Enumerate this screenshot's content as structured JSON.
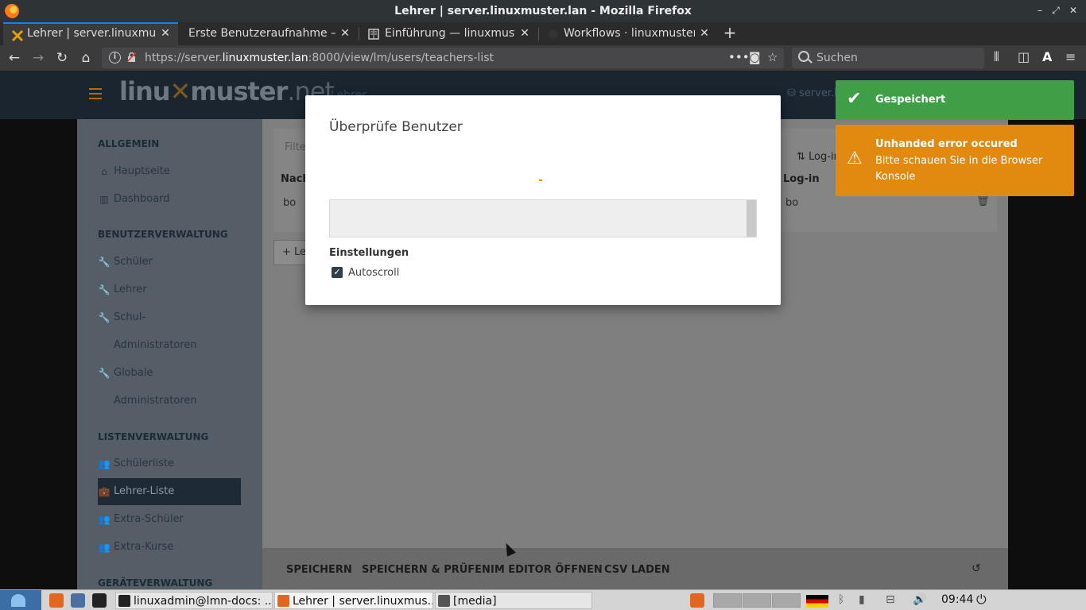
{
  "window": {
    "title": "Lehrer | server.linuxmuster.lan - Mozilla Firefox",
    "controls": [
      "–",
      "⤢",
      "✕"
    ]
  },
  "tabs": [
    {
      "label": "Lehrer | server.linuxmust",
      "icon": "linuxmuster-icon",
      "active": true
    },
    {
      "label": "Erste Benutzeraufnahme —",
      "icon": "",
      "active": false
    },
    {
      "label": "Einführung — linuxmuste",
      "icon": "doc-icon",
      "active": false
    },
    {
      "label": "Workflows · linuxmuster",
      "icon": "github-icon",
      "active": false
    }
  ],
  "navbar": {
    "url_prefix": "https://server.",
    "url_host": "linuxmuster.lan",
    "url_suffix": ":8000/view/lm/users/teachers-list",
    "search_placeholder": "Suchen"
  },
  "header": {
    "logo_a": "linu",
    "logo_x": "✕",
    "logo_b": "muster",
    "logo_c": ".net",
    "page_title": "Lehrer",
    "server": "server.li"
  },
  "sidebar": {
    "sections": [
      {
        "title": "ALLGEMEIN"
      },
      {
        "title": "BENUTZERVERWALTUNG"
      },
      {
        "title": "LISTENVERWALTUNG"
      },
      {
        "title": "GERÄTEVERWALTUNG"
      }
    ],
    "items": [
      {
        "label": "Hauptseite",
        "icon": "⌂"
      },
      {
        "label": "Dashboard",
        "icon": "▥"
      },
      {
        "label": "Schüler",
        "icon": "🔧"
      },
      {
        "label": "Lehrer",
        "icon": "🔧"
      },
      {
        "label": "Schul-",
        "icon": "🔧"
      },
      {
        "label": "Administratoren",
        "icon": ""
      },
      {
        "label": "Globale",
        "icon": "🔧"
      },
      {
        "label": "Administratoren",
        "icon": ""
      },
      {
        "label": "Schülerliste",
        "icon": "👥"
      },
      {
        "label": "Lehrer-Liste",
        "icon": "💼"
      },
      {
        "label": "Extra-Schüler",
        "icon": "👥"
      },
      {
        "label": "Extra-Kurse",
        "icon": "👥"
      }
    ]
  },
  "main": {
    "filter_placeholder": "Filte",
    "login_button": "Log-in",
    "columns": [
      "Nach",
      "Log-in"
    ],
    "row": [
      "bo",
      "bo"
    ],
    "add_button": "+ Le",
    "bottom_buttons": [
      "SPEICHERN",
      "SPEICHERN & PRÜFEN",
      "IM EDITOR ÖFFNEN",
      "CSV LADEN"
    ]
  },
  "modal": {
    "title": "Überprüfe Benutzer",
    "settings_label": "Einstellungen",
    "autoscroll_label": "Autoscroll",
    "autoscroll_checked": true
  },
  "toasts": {
    "success": {
      "title": "Gespeichert",
      "color": "#3f9f47"
    },
    "error": {
      "title": "Unhanded error occured",
      "message": "Bitte schauen Sie in die Browser Konsole",
      "color": "#e28a10"
    }
  },
  "taskbar": {
    "tasks": [
      {
        "label": "linuxadmin@lmn-docs: ...",
        "icon": "terminal-icon"
      },
      {
        "label": "Lehrer | server.linuxmus...",
        "icon": "firefox-icon",
        "active": true
      },
      {
        "label": "[media]",
        "icon": "folder-icon"
      }
    ],
    "time": "09:44"
  }
}
